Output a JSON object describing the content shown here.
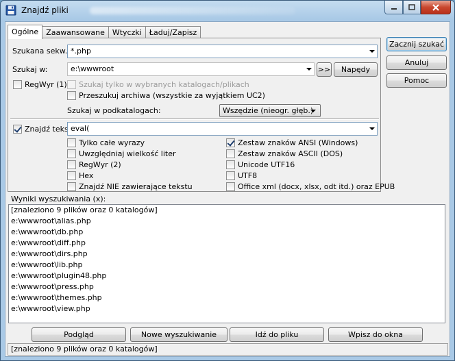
{
  "window": {
    "title": "Znajdź pliki",
    "colors": {
      "accent": "#3c7fb1",
      "close": "#c9482f",
      "frame": "#a9c9e6"
    }
  },
  "tabs": [
    {
      "label": "Ogólne",
      "active": true
    },
    {
      "label": "Zaawansowane",
      "active": false
    },
    {
      "label": "Wtyczki",
      "active": false
    },
    {
      "label": "Ładuj/Zapisz",
      "active": false
    }
  ],
  "general": {
    "search_for_label": "Szukana sekw.:",
    "search_for_value": "*.php",
    "search_in_label": "Szukaj w:",
    "search_in_value": "e:\\wwwroot",
    "browse_label": ">>",
    "drives_label": "Napędy",
    "regex_label": "RegWyr (1)",
    "only_selected_label": "Szukaj tylko w wybranych katalogach/plikach",
    "archives_label": "Przeszukuj archiwa (wszystkie za wyjątkiem UC2)",
    "subdirs_label": "Szukaj w podkatalogach:",
    "subdirs_value": "Wszędzie (nieogr. głęb.)",
    "find_text_label": "Znajdź tekst:",
    "find_text_value": "eval(",
    "options_left": [
      {
        "label": "Tylko całe wyrazy",
        "checked": false
      },
      {
        "label": "Uwzględniaj wielkość liter",
        "checked": false
      },
      {
        "label": "RegWyr (2)",
        "checked": false
      },
      {
        "label": "Hex",
        "checked": false
      },
      {
        "label": "Znajdź NIE zawierające tekstu",
        "checked": false
      }
    ],
    "options_right": [
      {
        "label": "Zestaw znaków ANSI (Windows)",
        "checked": true
      },
      {
        "label": "Zestaw znaków ASCII (DOS)",
        "checked": false
      },
      {
        "label": "Unicode UTF16",
        "checked": false
      },
      {
        "label": "UTF8",
        "checked": false
      },
      {
        "label": "Office xml (docx, xlsx, odt itd.) oraz EPUB",
        "checked": false
      }
    ]
  },
  "side_buttons": {
    "start": "Zacznij szukać",
    "cancel": "Anuluj",
    "help": "Pomoc"
  },
  "results": {
    "label": "Wyniki wyszukiwania (x):",
    "items": [
      "[znaleziono 9 plików oraz 0 katalogów]",
      "e:\\wwwroot\\alias.php",
      "e:\\wwwroot\\db.php",
      "e:\\wwwroot\\diff.php",
      "e:\\wwwroot\\dirs.php",
      "e:\\wwwroot\\lib.php",
      "e:\\wwwroot\\plugin48.php",
      "e:\\wwwroot\\press.php",
      "e:\\wwwroot\\themes.php",
      "e:\\wwwroot\\view.php"
    ]
  },
  "bottom_buttons": {
    "view": "Podgląd",
    "new_search": "Nowe wyszukiwanie",
    "goto": "Idź do pliku",
    "feed": "Wpisz do okna"
  },
  "status": "[znaleziono 9 plików oraz 0 katalogów]"
}
